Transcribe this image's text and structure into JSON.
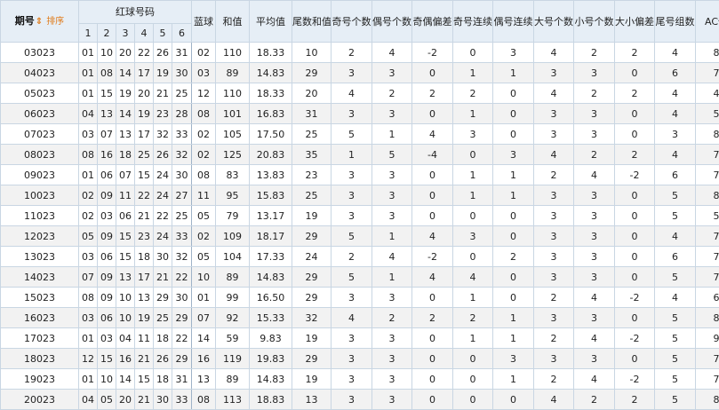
{
  "header": {
    "period": "期号",
    "sort_label": "排序",
    "red_group": "红球号码",
    "red_positions": [
      "1",
      "2",
      "3",
      "4",
      "5",
      "6"
    ],
    "blue": "蓝球",
    "columns": [
      "和值",
      "平均值",
      "尾数和值",
      "奇号个数",
      "偶号个数",
      "奇偶偏差",
      "奇号连续",
      "偶号连续",
      "大号个数",
      "小号个数",
      "大小偏差",
      "尾号组数",
      "AC值"
    ]
  },
  "rows": [
    [
      "03023",
      "01",
      "10",
      "20",
      "22",
      "26",
      "31",
      "02",
      "110",
      "18.33",
      "10",
      "2",
      "4",
      "-2",
      "0",
      "3",
      "4",
      "2",
      "2",
      "4",
      "8"
    ],
    [
      "04023",
      "01",
      "08",
      "14",
      "17",
      "19",
      "30",
      "03",
      "89",
      "14.83",
      "29",
      "3",
      "3",
      "0",
      "1",
      "1",
      "3",
      "3",
      "0",
      "6",
      "7"
    ],
    [
      "05023",
      "01",
      "15",
      "19",
      "20",
      "21",
      "25",
      "12",
      "110",
      "18.33",
      "20",
      "4",
      "2",
      "2",
      "2",
      "0",
      "4",
      "2",
      "2",
      "4",
      "4"
    ],
    [
      "06023",
      "04",
      "13",
      "14",
      "19",
      "23",
      "28",
      "08",
      "101",
      "16.83",
      "31",
      "3",
      "3",
      "0",
      "1",
      "0",
      "3",
      "3",
      "0",
      "4",
      "5"
    ],
    [
      "07023",
      "03",
      "07",
      "13",
      "17",
      "32",
      "33",
      "02",
      "105",
      "17.50",
      "25",
      "5",
      "1",
      "4",
      "3",
      "0",
      "3",
      "3",
      "0",
      "3",
      "8"
    ],
    [
      "08023",
      "08",
      "16",
      "18",
      "25",
      "26",
      "32",
      "02",
      "125",
      "20.83",
      "35",
      "1",
      "5",
      "-4",
      "0",
      "3",
      "4",
      "2",
      "2",
      "4",
      "7"
    ],
    [
      "09023",
      "01",
      "06",
      "07",
      "15",
      "24",
      "30",
      "08",
      "83",
      "13.83",
      "23",
      "3",
      "3",
      "0",
      "1",
      "1",
      "2",
      "4",
      "-2",
      "6",
      "7"
    ],
    [
      "10023",
      "02",
      "09",
      "11",
      "22",
      "24",
      "27",
      "11",
      "95",
      "15.83",
      "25",
      "3",
      "3",
      "0",
      "1",
      "1",
      "3",
      "3",
      "0",
      "5",
      "8"
    ],
    [
      "11023",
      "02",
      "03",
      "06",
      "21",
      "22",
      "25",
      "05",
      "79",
      "13.17",
      "19",
      "3",
      "3",
      "0",
      "0",
      "0",
      "3",
      "3",
      "0",
      "5",
      "5"
    ],
    [
      "12023",
      "05",
      "09",
      "15",
      "23",
      "24",
      "33",
      "02",
      "109",
      "18.17",
      "29",
      "5",
      "1",
      "4",
      "3",
      "0",
      "3",
      "3",
      "0",
      "4",
      "7"
    ],
    [
      "13023",
      "03",
      "06",
      "15",
      "18",
      "30",
      "32",
      "05",
      "104",
      "17.33",
      "24",
      "2",
      "4",
      "-2",
      "0",
      "2",
      "3",
      "3",
      "0",
      "6",
      "7"
    ],
    [
      "14023",
      "07",
      "09",
      "13",
      "17",
      "21",
      "22",
      "10",
      "89",
      "14.83",
      "29",
      "5",
      "1",
      "4",
      "4",
      "0",
      "3",
      "3",
      "0",
      "5",
      "7"
    ],
    [
      "15023",
      "08",
      "09",
      "10",
      "13",
      "29",
      "30",
      "01",
      "99",
      "16.50",
      "29",
      "3",
      "3",
      "0",
      "1",
      "0",
      "2",
      "4",
      "-2",
      "4",
      "6"
    ],
    [
      "16023",
      "03",
      "06",
      "10",
      "19",
      "25",
      "29",
      "07",
      "92",
      "15.33",
      "32",
      "4",
      "2",
      "2",
      "2",
      "1",
      "3",
      "3",
      "0",
      "5",
      "8"
    ],
    [
      "17023",
      "01",
      "03",
      "04",
      "11",
      "18",
      "22",
      "14",
      "59",
      "9.83",
      "19",
      "3",
      "3",
      "0",
      "1",
      "1",
      "2",
      "4",
      "-2",
      "5",
      "9"
    ],
    [
      "18023",
      "12",
      "15",
      "16",
      "21",
      "26",
      "29",
      "16",
      "119",
      "19.83",
      "29",
      "3",
      "3",
      "0",
      "0",
      "3",
      "3",
      "3",
      "0",
      "5",
      "7"
    ],
    [
      "19023",
      "01",
      "10",
      "14",
      "15",
      "18",
      "31",
      "13",
      "89",
      "14.83",
      "19",
      "3",
      "3",
      "0",
      "0",
      "1",
      "2",
      "4",
      "-2",
      "5",
      "7"
    ],
    [
      "20023",
      "04",
      "05",
      "20",
      "21",
      "30",
      "33",
      "08",
      "113",
      "18.83",
      "13",
      "3",
      "3",
      "0",
      "0",
      "0",
      "4",
      "2",
      "2",
      "5",
      "8"
    ]
  ]
}
